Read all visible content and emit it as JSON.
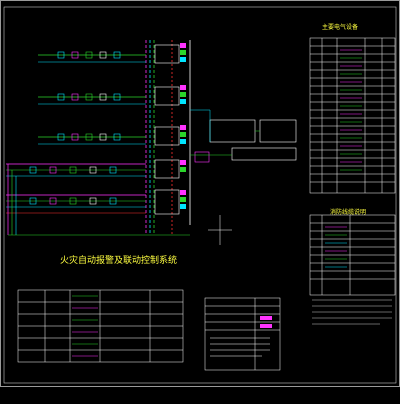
{
  "drawing": {
    "title": "火灾自动报警及联动控制系统",
    "legend_title": "主要电气设备",
    "fire_title": "消防线缆说明"
  },
  "colors": {
    "background": "#000000",
    "frame": "#c8c8c8",
    "cyan": "#00e5ff",
    "green": "#2bd62b",
    "magenta": "#ff33ff",
    "yellow": "#ffff40",
    "red": "#ff3030",
    "white": "#ffffff"
  }
}
